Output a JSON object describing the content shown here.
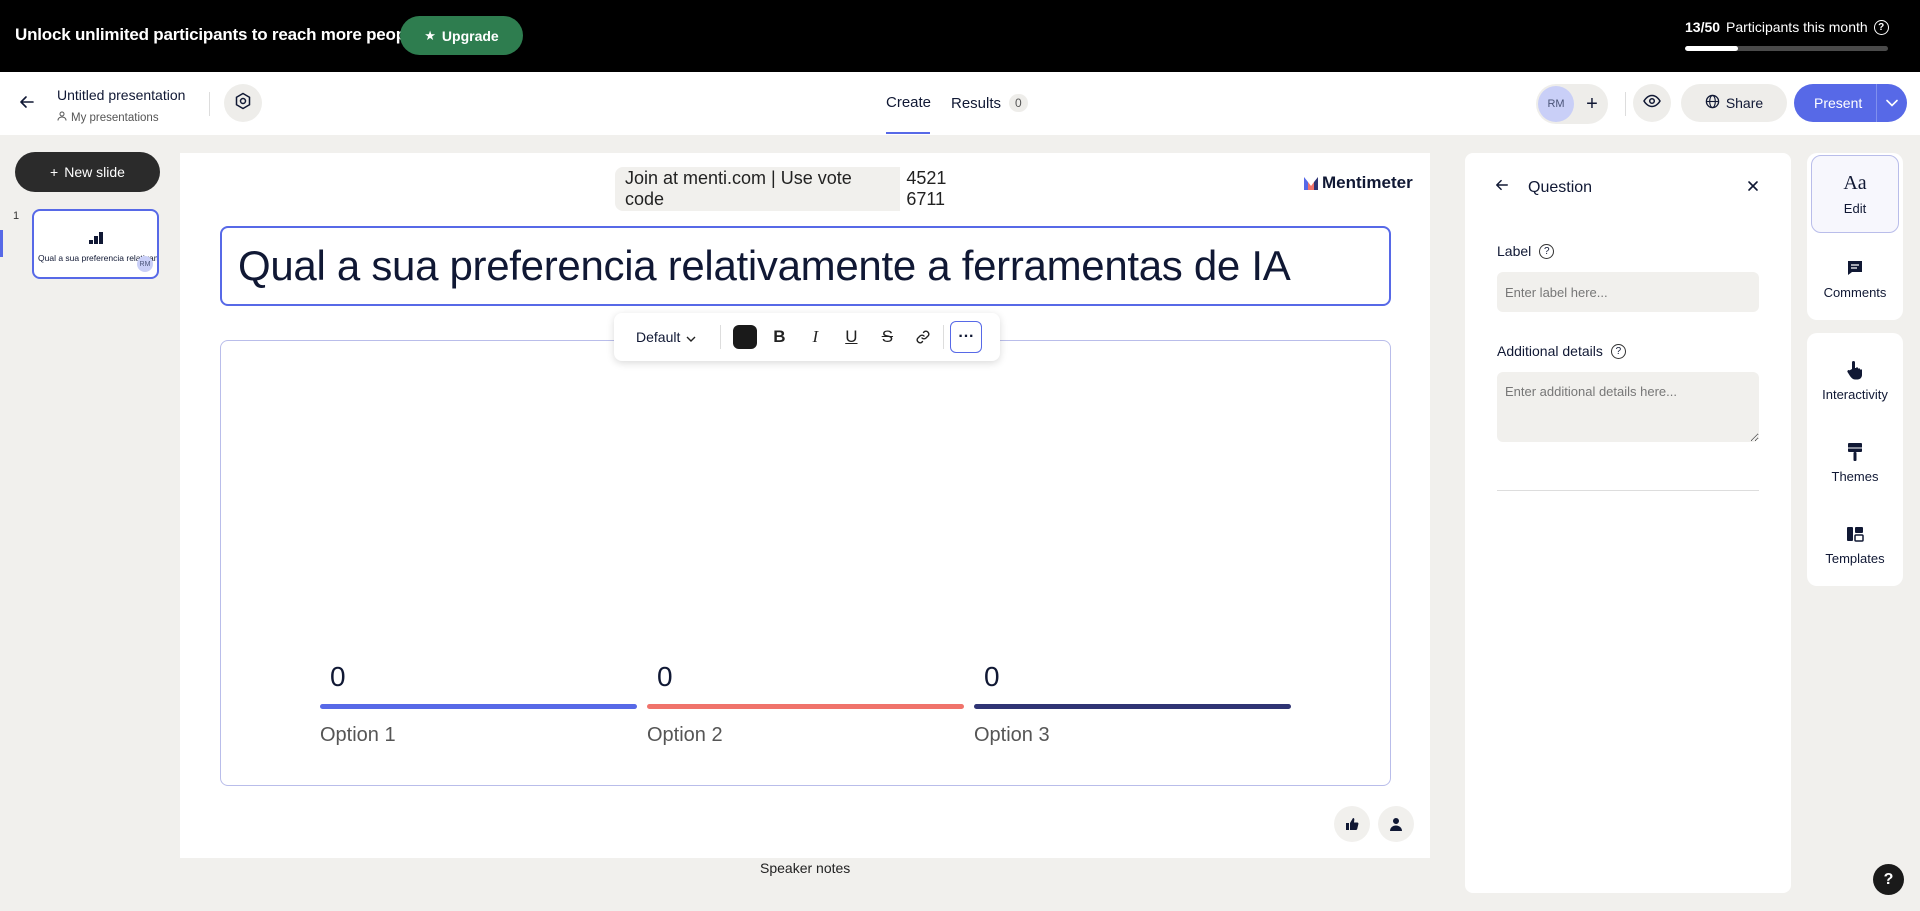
{
  "banner": {
    "text": "Unlock unlimited participants to reach more people.",
    "upgrade_label": "Upgrade",
    "participants_count": "13/50",
    "participants_label": "Participants this month",
    "progress_fraction": 0.26
  },
  "header": {
    "title": "Untitled presentation",
    "breadcrumb": "My presentations",
    "tab_create": "Create",
    "tab_results": "Results",
    "results_count": "0",
    "avatar_initials": "RM",
    "share_label": "Share",
    "present_label": "Present"
  },
  "sidebar": {
    "new_slide_label": "New slide",
    "slides": [
      {
        "number": "1",
        "title": "Qual a sua preferencia relativamente a ferramentas de IA",
        "avatar": "RM"
      }
    ]
  },
  "canvas": {
    "join_text": "Join at menti.com | Use vote code",
    "vote_code": "4521 6711",
    "brand": "Mentimeter",
    "question_title": "Qual a sua preferencia relativamente a ferramentas de IA",
    "toolbar": {
      "font_label": "Default",
      "text_color": "#1a1a1a"
    },
    "speaker_notes": "Speaker notes"
  },
  "chart_data": {
    "type": "bar",
    "categories": [
      "Option 1",
      "Option 2",
      "Option 3"
    ],
    "values": [
      0,
      0,
      0
    ],
    "colors": [
      "#5769e7",
      "#f0736b",
      "#2f3474"
    ]
  },
  "panel": {
    "title": "Question",
    "label_heading": "Label",
    "label_placeholder": "Enter label here...",
    "details_heading": "Additional details",
    "details_placeholder": "Enter additional details here..."
  },
  "rail": {
    "edit": "Edit",
    "comments": "Comments",
    "interactivity": "Interactivity",
    "themes": "Themes",
    "templates": "Templates"
  },
  "help_label": "?"
}
